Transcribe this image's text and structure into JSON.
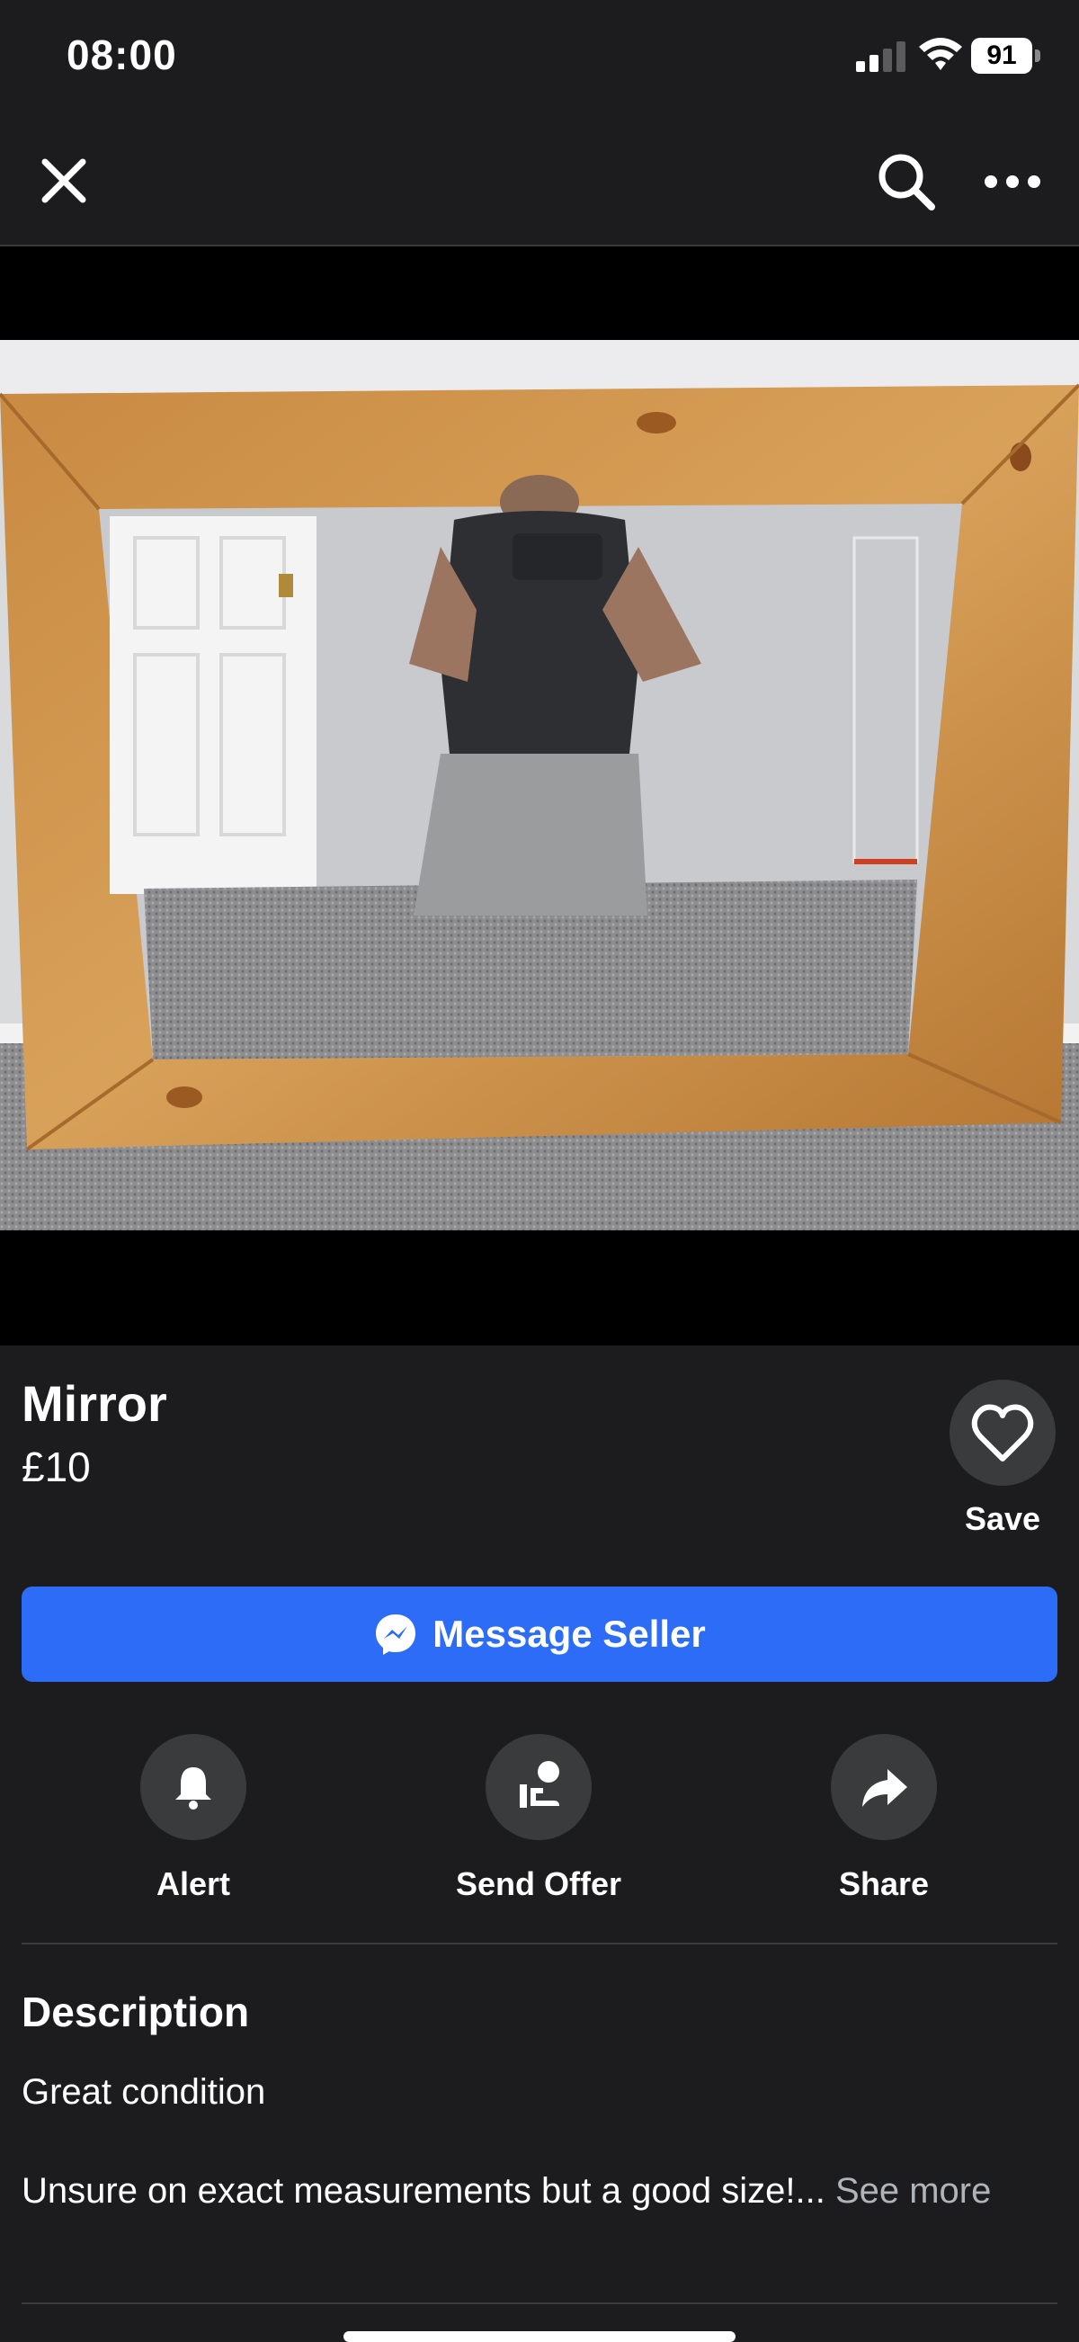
{
  "status_bar": {
    "time": "08:00",
    "battery": "91"
  },
  "listing": {
    "title": "Mirror",
    "price": "£10",
    "save_label": "Save",
    "message_button": "Message Seller"
  },
  "actions": [
    {
      "label": "Alert",
      "icon": "bell-icon"
    },
    {
      "label": "Send Offer",
      "icon": "hand-offer-icon"
    },
    {
      "label": "Share",
      "icon": "share-arrow-icon"
    }
  ],
  "description": {
    "heading": "Description",
    "line1": "Great condition",
    "line2": "Unsure on exact measurements but a good size!...",
    "see_more": "See more"
  },
  "colors": {
    "background": "#1c1c1e",
    "accent": "#2d6cf6",
    "circle": "#3a3b3c"
  }
}
